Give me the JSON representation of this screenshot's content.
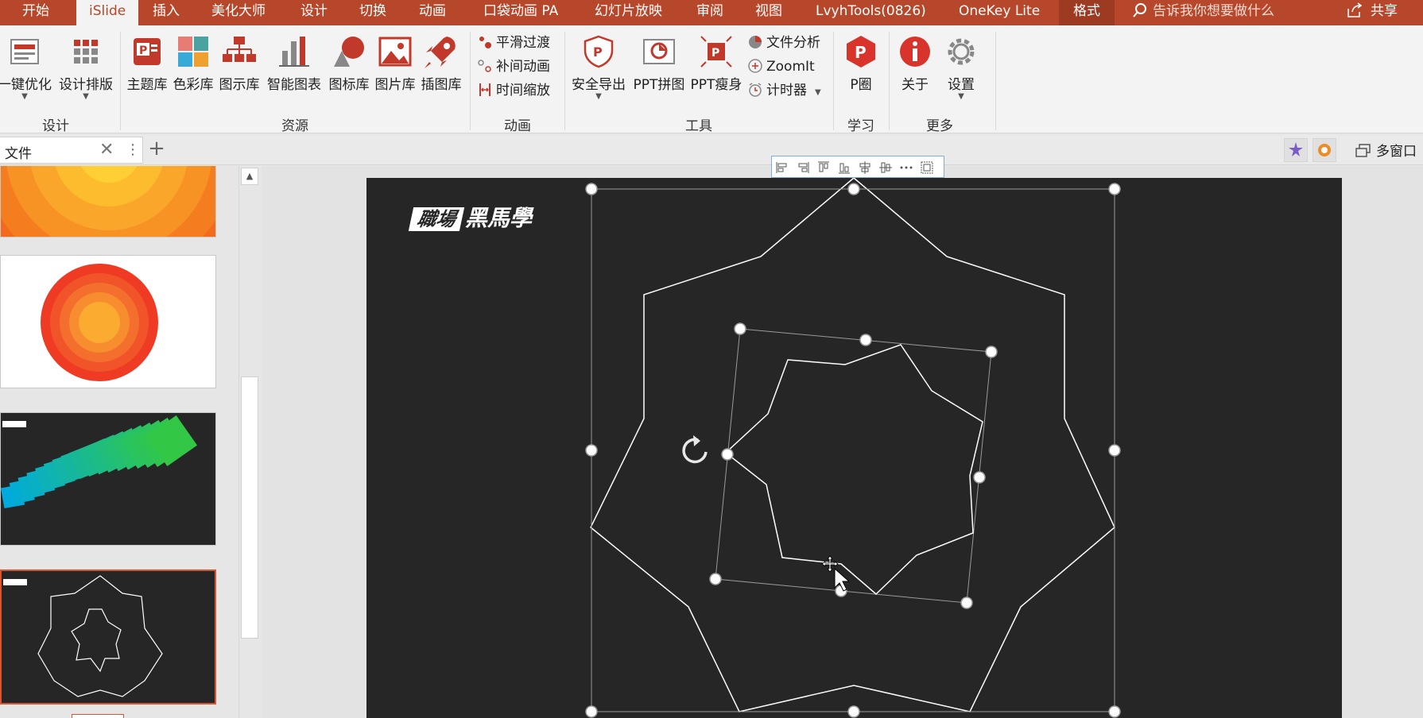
{
  "tabs": [
    {
      "label": "开始"
    },
    {
      "label": "iSlide",
      "active": true
    },
    {
      "label": "插入"
    },
    {
      "label": "美化大师"
    },
    {
      "label": "设计"
    },
    {
      "label": "切换"
    },
    {
      "label": "动画"
    },
    {
      "label": "口袋动画 PA"
    },
    {
      "label": "幻灯片放映"
    },
    {
      "label": "审阅"
    },
    {
      "label": "视图"
    },
    {
      "label": "LvyhTools(0826)"
    },
    {
      "label": "OneKey Lite"
    },
    {
      "label": "格式"
    }
  ],
  "search": {
    "placeholder": "告诉我你想要做什么"
  },
  "share": {
    "label": "共享"
  },
  "ribbon": {
    "design_group": {
      "label": "设计",
      "items": [
        {
          "label": "一键优化"
        },
        {
          "label": "设计排版"
        }
      ]
    },
    "resource_group": {
      "label": "资源",
      "items": [
        {
          "label": "主题库"
        },
        {
          "label": "色彩库"
        },
        {
          "label": "图示库"
        },
        {
          "label": "智能图表"
        },
        {
          "label": "图标库"
        },
        {
          "label": "图片库"
        },
        {
          "label": "插图库"
        }
      ]
    },
    "animation_group": {
      "label": "动画",
      "items": [
        {
          "label": "平滑过渡"
        },
        {
          "label": "补间动画"
        },
        {
          "label": "时间缩放"
        }
      ]
    },
    "tools_group": {
      "label": "工具",
      "items": [
        {
          "label": "安全导出"
        },
        {
          "label": "PPT拼图"
        },
        {
          "label": "PPT瘦身"
        }
      ],
      "small_items": [
        {
          "label": "文件分析"
        },
        {
          "label": "ZoomIt"
        },
        {
          "label": "计时器"
        }
      ]
    },
    "learn_group": {
      "label": "学习",
      "items": [
        {
          "label": "P圈"
        }
      ]
    },
    "more_group": {
      "label": "更多",
      "items": [
        {
          "label": "关于"
        },
        {
          "label": "设置"
        }
      ]
    }
  },
  "doc_tab": {
    "label": "文件"
  },
  "multi_window": {
    "label": "多窗口"
  },
  "slide": {
    "logo_part1": "職場",
    "logo_part2": "黑馬學"
  },
  "colors": {
    "accent": "#b7472a",
    "slide_bg": "#262626",
    "selection": "#d9542f"
  },
  "icons": {
    "search": "search-icon",
    "share": "share-icon",
    "close": "close-icon",
    "add": "plus-icon",
    "rotate": "rotate-icon",
    "move": "move-cursor-icon"
  }
}
